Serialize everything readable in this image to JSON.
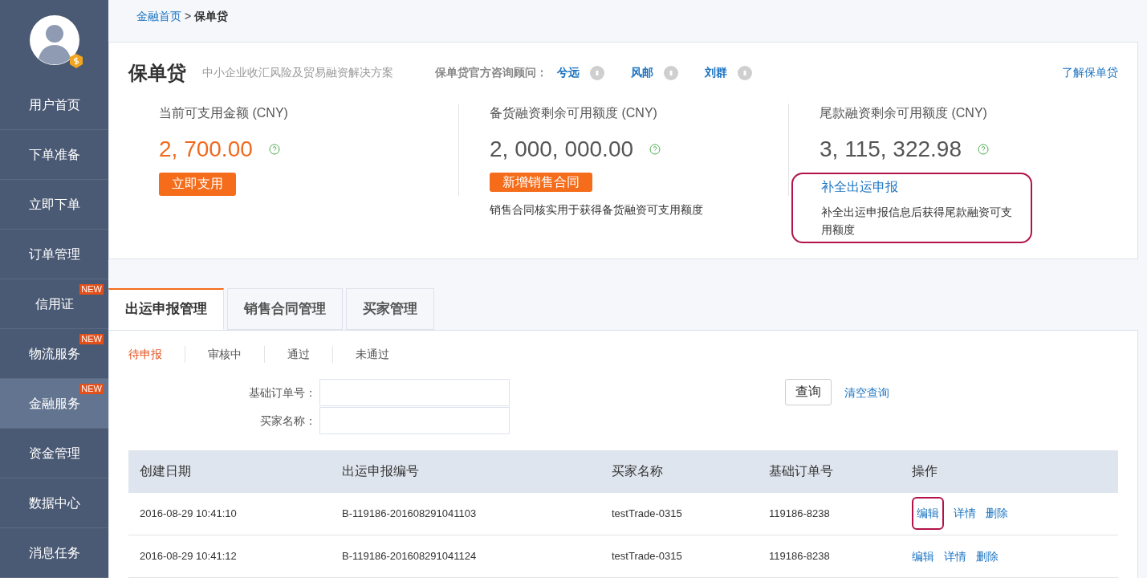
{
  "sidebar": {
    "items": [
      {
        "label": "用户首页",
        "selected": false
      },
      {
        "label": "下单准备",
        "selected": false
      },
      {
        "label": "立即下单",
        "selected": false
      },
      {
        "label": "订单管理",
        "selected": false
      },
      {
        "label": "信用证",
        "selected": false,
        "badge": "NEW"
      },
      {
        "label": "物流服务",
        "selected": false,
        "badge": "NEW"
      },
      {
        "label": "金融服务",
        "selected": true,
        "badge": "NEW"
      },
      {
        "label": "资金管理",
        "selected": false
      },
      {
        "label": "数据中心",
        "selected": false
      },
      {
        "label": "消息任务",
        "selected": false
      }
    ]
  },
  "breadcrumb": {
    "link": "金融首页",
    "separator": ">",
    "current": "保单贷"
  },
  "product": {
    "title": "保单贷",
    "subtitle": "中小企业收汇风险及贸易融资解决方案",
    "advisors_label": "保单贷官方咨询顾问：",
    "advisors": [
      "兮远",
      "风邮",
      "刘群"
    ],
    "learn_more": "了解保单贷"
  },
  "balances": [
    {
      "label": "当前可支用金额 (CNY)",
      "amount": "2, 700.00",
      "highlight": true,
      "button": "立即支用"
    },
    {
      "label": "备货融资剩余可用额度 (CNY)",
      "amount": "2, 000, 000.00",
      "highlight": false,
      "button": "新增销售合同",
      "note": "销售合同核实用于获得备货融资可支用额度"
    },
    {
      "label": "尾款融资剩余可用额度 (CNY)",
      "amount": "3, 115, 322.98",
      "highlight": false,
      "link": "补全出运申报",
      "note": "补全出运申报信息后获得尾款融资可支用额度",
      "annotated": true
    }
  ],
  "tabs": [
    {
      "label": "出运申报管理",
      "selected": true
    },
    {
      "label": "销售合同管理",
      "selected": false
    },
    {
      "label": "买家管理",
      "selected": false
    }
  ],
  "filters": [
    {
      "label": "待申报",
      "selected": true
    },
    {
      "label": "审核中",
      "selected": false
    },
    {
      "label": "通过",
      "selected": false
    },
    {
      "label": "未通过",
      "selected": false
    }
  ],
  "search": {
    "fields": [
      {
        "label": "基础订单号："
      },
      {
        "label": "买家名称："
      }
    ],
    "submit": "查询",
    "clear": "清空查询"
  },
  "table": {
    "columns": [
      "创建日期",
      "出运申报编号",
      "买家名称",
      "基础订单号",
      "操作"
    ],
    "rows": [
      {
        "cells": [
          "2016-08-29 10:41:10",
          "B-119186-201608291041103",
          "testTrade-0315",
          "119186-8238"
        ],
        "actions": [
          "编辑",
          "详情",
          "删除"
        ],
        "annotated": true
      },
      {
        "cells": [
          "2016-08-29 10:41:12",
          "B-119186-201608291041124",
          "testTrade-0315",
          "119186-8238"
        ],
        "actions": [
          "编辑",
          "详情",
          "删除"
        ],
        "annotated": false
      }
    ]
  }
}
